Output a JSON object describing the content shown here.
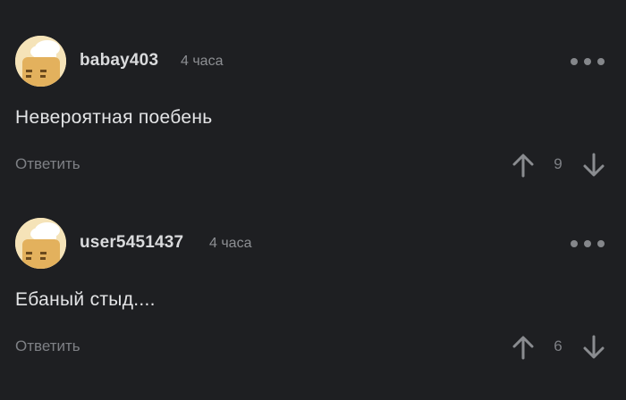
{
  "comments": [
    {
      "username": "babay403",
      "time": "4 часа",
      "text": "Невероятная поебень",
      "reply_label": "Ответить",
      "rating": "9",
      "avatar_icon": "chef-bread-avatar-icon"
    },
    {
      "username": "user5451437",
      "time": "4 часа",
      "text": "Ебаный стыд....",
      "reply_label": "Ответить",
      "rating": "6",
      "avatar_icon": "chef-bread-avatar-icon"
    }
  ],
  "colors": {
    "background": "#1e1f22",
    "username": "#d9dadc",
    "muted": "#7e8085",
    "avatar_bg": "#f5e3b8"
  }
}
